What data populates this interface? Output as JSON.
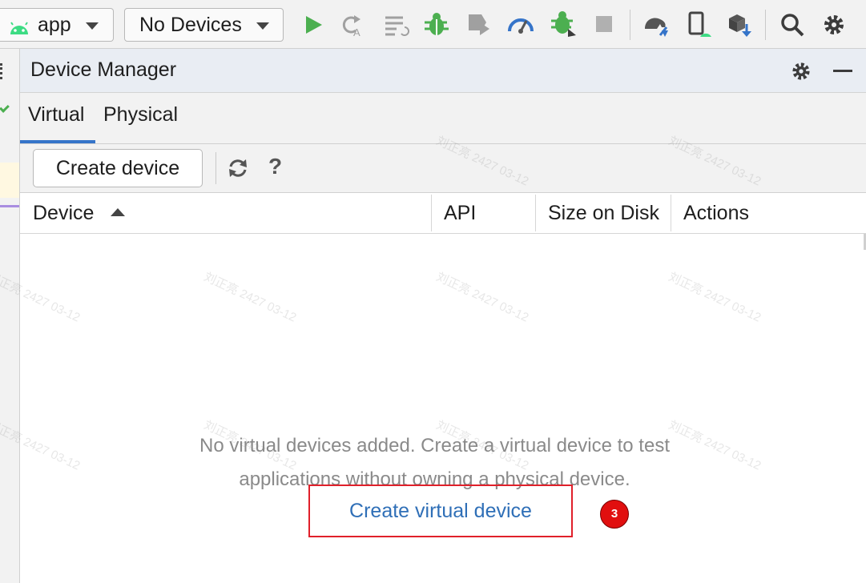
{
  "toolbar": {
    "module_label": "app",
    "device_label": "No Devices",
    "icons": [
      "android-icon",
      "run-icon",
      "apply-changes-icon",
      "apply-code-changes-icon",
      "debug-icon",
      "profile-icon",
      "attach-debugger-icon",
      "coverage-icon",
      "stop-icon",
      "gradle-sync-icon",
      "device-manager-icon",
      "sdk-manager-icon",
      "search-icon",
      "settings-icon"
    ],
    "colors": {
      "android": "#3ddc84",
      "run": "#4caf50",
      "debug": "#4caf50",
      "profile": "#3574c9"
    }
  },
  "tool_window": {
    "title": "Device Manager",
    "tabs": [
      {
        "label": "Virtual",
        "active": true
      },
      {
        "label": "Physical",
        "active": false
      }
    ],
    "create_button": "Create device",
    "help_label": "?",
    "columns": [
      "Device",
      "API",
      "Size on Disk",
      "Actions"
    ],
    "sort_column": "Device",
    "empty_message_line1": "No virtual devices added. Create a virtual device to test",
    "empty_message_line2": "applications without owning a physical device.",
    "create_link": "Create virtual device",
    "accent_color": "#3574c9",
    "link_color": "#2f6fb7"
  },
  "annotation": {
    "step_number": "3",
    "highlight_color": "#e0202a"
  },
  "watermark": "刘正亮 2427 03-12"
}
